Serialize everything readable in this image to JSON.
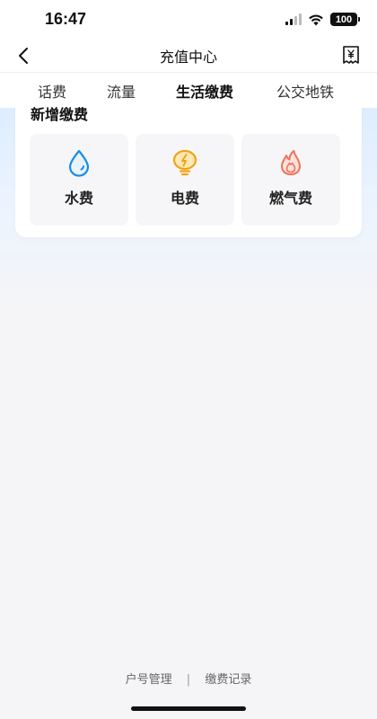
{
  "status_bar": {
    "time": "16:47",
    "battery": "100"
  },
  "nav": {
    "title": "充值中心"
  },
  "tabs": [
    {
      "label": "话费"
    },
    {
      "label": "流量"
    },
    {
      "label": "生活缴费",
      "active": true
    },
    {
      "label": "公交地铁"
    }
  ],
  "section": {
    "title": "新增缴费",
    "tiles": [
      {
        "label": "水费",
        "icon": "water-drop-icon"
      },
      {
        "label": "电费",
        "icon": "lightbulb-icon"
      },
      {
        "label": "燃气费",
        "icon": "flame-icon"
      }
    ]
  },
  "footer": {
    "account_label": "户号管理",
    "separator": "|",
    "records_label": "缴费记录"
  },
  "colors": {
    "accent": "#1a8be6",
    "water": "#1a8be6",
    "electric": "#f2a312",
    "gas": "#f0705a"
  }
}
